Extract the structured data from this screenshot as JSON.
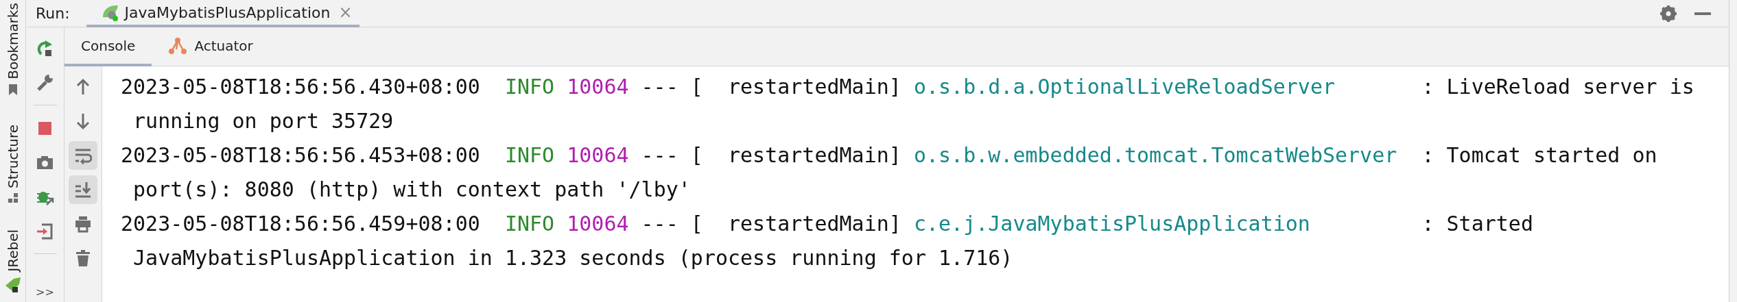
{
  "side_tabs": [
    {
      "label": "Bookmarks",
      "kind": "bookmarks"
    },
    {
      "label": "Structure",
      "kind": "structure"
    },
    {
      "label": "JRebel",
      "kind": "jrebel"
    }
  ],
  "run_bar": {
    "label": "Run:",
    "tab": {
      "title": "JavaMybatisPlusApplication",
      "close": "×",
      "selected": true
    }
  },
  "actions": [
    {
      "kind": "rerun"
    },
    {
      "kind": "wrench"
    },
    {
      "kind": "separator"
    },
    {
      "kind": "stop"
    },
    {
      "kind": "camera"
    },
    {
      "kind": "debug"
    },
    {
      "kind": "exit"
    },
    {
      "kind": "separator"
    }
  ],
  "more": ">>",
  "console_tabs": [
    {
      "label": "Console",
      "kind": "plain",
      "selected": true
    },
    {
      "label": "Actuator",
      "kind": "actuator",
      "selected": false
    }
  ],
  "console_tools": [
    {
      "kind": "up",
      "selected": false
    },
    {
      "kind": "down",
      "selected": false
    },
    {
      "kind": "wrap",
      "selected": true
    },
    {
      "kind": "scroll-end",
      "selected": true
    },
    {
      "kind": "print",
      "selected": false
    },
    {
      "kind": "trash",
      "selected": false
    }
  ],
  "log": [
    {
      "timestamp": "2023-05-08T18:56:56.430+08:00",
      "level": "INFO",
      "pid": "10064",
      "thread": "--- [  restartedMain]",
      "logger": "o.s.b.d.a.OptionalLiveReloadServer",
      "message": ": LiveReload server is",
      "continuation": "running on port 35729"
    },
    {
      "timestamp": "2023-05-08T18:56:56.453+08:00",
      "level": "INFO",
      "pid": "10064",
      "thread": "--- [  restartedMain]",
      "logger": "o.s.b.w.embedded.tomcat.TomcatWebServer",
      "message": ": Tomcat started on",
      "continuation": "port(s): 8080 (http) with context path '/lby'"
    },
    {
      "timestamp": "2023-05-08T18:56:56.459+08:00",
      "level": "INFO",
      "pid": "10064",
      "thread": "--- [  restartedMain]",
      "logger": "c.e.j.JavaMybatisPlusApplication",
      "message": ": Started",
      "continuation": "JavaMybatisPlusApplication in 1.323 seconds (process running for 1.716)"
    }
  ]
}
